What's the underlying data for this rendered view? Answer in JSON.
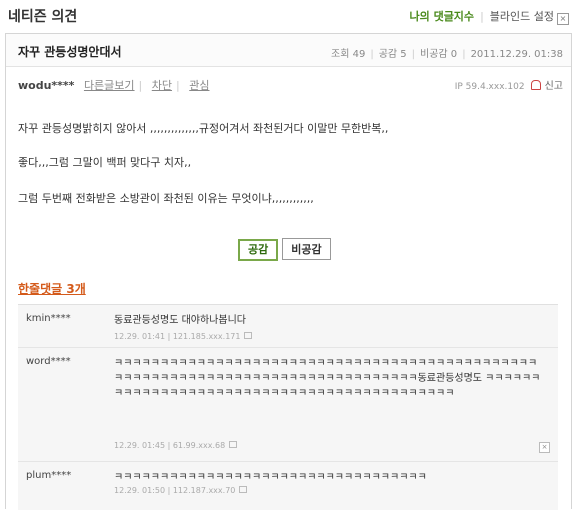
{
  "page": {
    "title": "네티즌 의견",
    "my_comment_count": "나의 댓글지수",
    "blind_setting": "블라인드 설정"
  },
  "post": {
    "title": "자꾸 관등성명안대서",
    "views_label": "조회 49",
    "agree_label": "공감 5",
    "disagree_label": "비공감 0",
    "datetime": "2011.12.29. 01:38",
    "author": "wodu****",
    "links": [
      "다른글보기",
      "차단",
      "관심"
    ],
    "ip": "IP 59.4.xxx.102",
    "report": "신고",
    "body": [
      "자꾸 관등성명밝히지 않아서 ,,,,,,,,,,,,,,규정어겨서 좌천된거다 이말만 무한반복,,",
      "좋다,,,그럼 그말이 백퍼 맞다구 치자,,",
      "그럼 두번째 전화받은 소방관이 좌천된 이유는 무엇이냐,,,,,,,,,,,,"
    ],
    "agree_button": "공감",
    "disagree_button": "비공감"
  },
  "comments": {
    "header": "한줄댓글 3개",
    "items": [
      {
        "author": "kmin****",
        "text": "동료관등성명도 대야하나봅니다",
        "meta": "12.29. 01:41 | 121.185.xxx.171"
      },
      {
        "author": "word****",
        "text": "ㅋㅋㅋㅋㅋㅋㅋㅋㅋㅋㅋㅋㅋㅋㅋㅋㅋㅋㅋㅋㅋㅋㅋㅋㅋㅋㅋㅋㅋㅋㅋㅋㅋㅋㅋㅋㅋㅋㅋㅋㅋㅋㅋㅋㅋㅋㅋㅋㅋㅋㅋㅋㅋㅋㅋㅋㅋㅋㅋㅋㅋㅋㅋㅋㅋㅋㅋㅋㅋㅋㅋㅋㅋㅋㅋㅋㅋㅋㅋ동료관등성명도 ㅋㅋㅋㅋㅋㅋㅋㅋㅋㅋㅋㅋㅋㅋㅋㅋㅋㅋㅋㅋㅋㅋㅋㅋㅋㅋㅋㅋㅋㅋㅋㅋㅋㅋㅋㅋㅋㅋㅋㅋㅋㅋㅋ",
        "meta": "12.29. 01:45 | 61.99.xxx.68"
      },
      {
        "author": "plum****",
        "text": "ㅋㅋㅋㅋㅋㅋㅋㅋㅋㅋㅋㅋㅋㅋㅋㅋㅋㅋㅋㅋㅋㅋㅋㅋㅋㅋㅋㅋㅋㅋㅋㅋㅋㅋ",
        "meta": "12.29. 01:50 | 112.187.xxx.70"
      }
    ]
  }
}
